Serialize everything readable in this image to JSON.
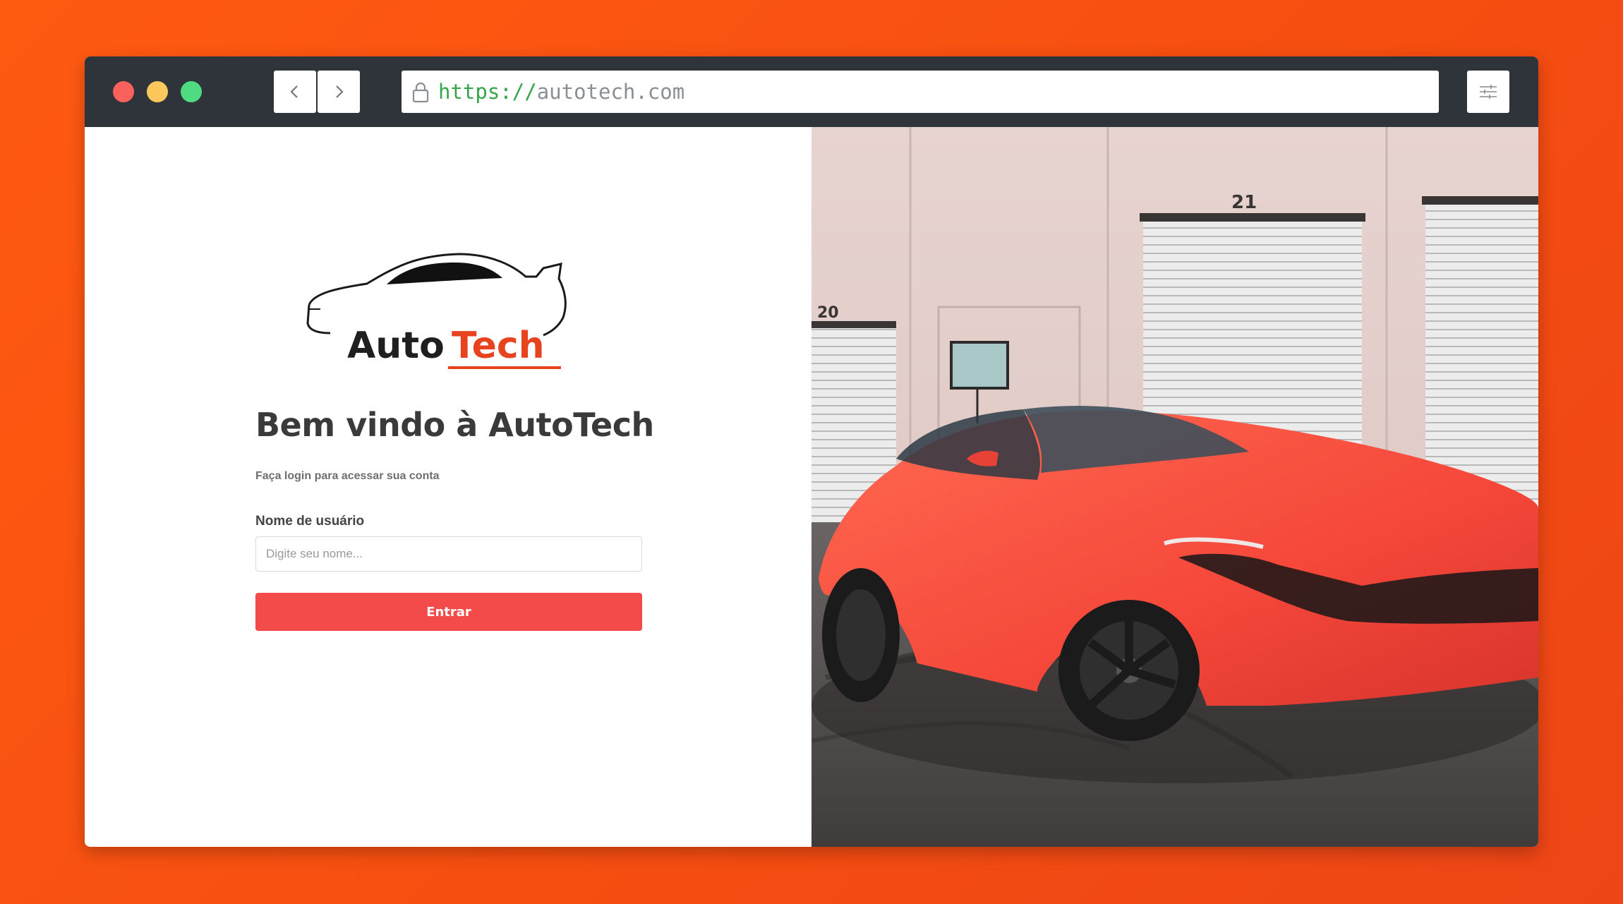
{
  "browser": {
    "url_scheme": "https://",
    "url_host": "autotech.com",
    "back_icon": "chevron-left-icon",
    "forward_icon": "chevron-right-icon",
    "settings_icon": "sliders-icon"
  },
  "logo": {
    "word1": "Auto",
    "word2": "Tech"
  },
  "login": {
    "title": "Bem vindo à AutoTech",
    "subtitle": "Faça login para acessar sua conta",
    "username_label": "Nome de usuário",
    "username_placeholder": "Digite seu nome...",
    "username_value": "",
    "submit_label": "Entrar"
  },
  "scene": {
    "garage_number_1": "20",
    "garage_number_2": "21"
  },
  "colors": {
    "background": "#f64e10",
    "accent": "#f34a4a",
    "brand_orange": "#e8431f",
    "titlebar": "#2e3439"
  }
}
